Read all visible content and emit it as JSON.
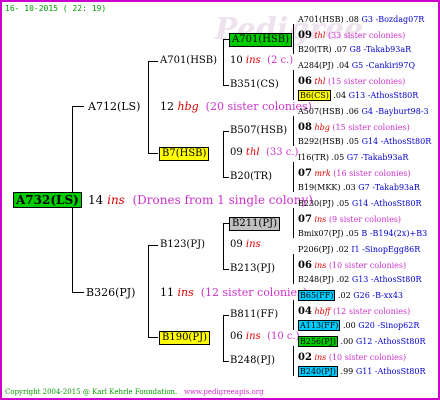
{
  "header": {
    "date": "16- 10-2015 ( 22: 19)"
  },
  "footer": {
    "copyright": "Copyright 2004-2015 @ Karl Kehrle Foundation.",
    "url": "www.pedigreeapis.org"
  },
  "watermark": "Pedigree",
  "colors": {
    "frame": "#cc00cc",
    "green_box": "#00cc00",
    "yellow_box": "#ffff00",
    "gray_box": "#c0c0c0",
    "cyan_box": "#00ccff"
  },
  "root": {
    "code": "A732(LS)",
    "num": "14",
    "sign": "ins",
    "note": "(Drones from 1 single colony)"
  },
  "gen1": {
    "top": {
      "code": "A712(LS)",
      "num": "12",
      "sign": "hbg",
      "note": "(20 sister colonies)"
    },
    "bottom": {
      "code": "B326(PJ)",
      "num": "11",
      "sign": "ins",
      "note": "(12 sister colonies)"
    }
  },
  "gen2": [
    {
      "code": "A701(HSB)",
      "num": "10",
      "sign": "ins",
      "note": "(2 c.)"
    },
    {
      "code": "B7(HSB)",
      "num": "09",
      "sign": "thl",
      "note": "(33 c.)"
    },
    {
      "code": "B123(PJ)",
      "num": "09",
      "sign": "ins",
      "note": ""
    },
    {
      "code": "B190(PJ)",
      "num": "06",
      "sign": "ins",
      "note": "(10 c.)"
    }
  ],
  "gen3": [
    {
      "code": "A701(HSB)"
    },
    {
      "code": "B351(CS)"
    },
    {
      "code": "B507(HSB)"
    },
    {
      "code": "B20(TR)"
    },
    {
      "code": "B211(PJ)"
    },
    {
      "code": "B213(PJ)"
    },
    {
      "code": "B811(FF)"
    },
    {
      "code": "B248(PJ)"
    }
  ],
  "gen4": [
    {
      "top": {
        "code": "A701(HSB)",
        "year": ".08",
        "sep": "G3 -",
        "breeder": "Bozdag07R"
      },
      "num": "09",
      "sign": "thl",
      "note": "(33 sister colonies)",
      "bottom": {
        "code": "B20(TR)",
        "year": ".07",
        "sep": "G8 -",
        "breeder": "Takab93aR"
      }
    },
    {
      "top": {
        "code": "A284(PJ)",
        "year": ".04",
        "sep": "G5 -",
        "breeder": "Cankiri97Q"
      },
      "num": "06",
      "sign": "thl",
      "note": "(15 sister colonies)",
      "bottom": {
        "code": "B6(CS)",
        "year": ".04",
        "sep": "G13 -",
        "breeder": "AthosSt80R"
      }
    },
    {
      "top": {
        "code": "A507(HSB)",
        "year": ".06",
        "sep": "G4 -",
        "breeder": "Bayburt98-3"
      },
      "num": "08",
      "sign": "hbg",
      "note": "(15 sister colonies)",
      "bottom": {
        "code": "B292(HSB)",
        "year": ".05",
        "sep": "G14 -",
        "breeder": "AthosSt80R"
      }
    },
    {
      "top": {
        "code": "I16(TR)",
        "year": ".05",
        "sep": "G7 -",
        "breeder": "Takab93aR"
      },
      "num": "07",
      "sign": "mrk",
      "note": "(16 sister colonies)",
      "bottom": {
        "code": "B19(MKK)",
        "year": ".03",
        "sep": "G7 -",
        "breeder": "Takab93aR"
      }
    },
    {
      "top": {
        "code": "B230(PJ)",
        "year": ".05",
        "sep": "G14 -",
        "breeder": "AthosSt80R"
      },
      "num": "07",
      "sign": "ins",
      "note": "(9 sister colonies)",
      "bottom": {
        "code": "Bmix07(PJ)",
        "year": ".05",
        "sep": "B -",
        "breeder": "B194(2x)+B3"
      }
    },
    {
      "top": {
        "code": "P206(PJ)",
        "year": ".02",
        "sep": "I1 -",
        "breeder": "SinopEgg86R"
      },
      "num": "06",
      "sign": "ins",
      "note": "(10 sister colonies)",
      "bottom": {
        "code": "B248(PJ)",
        "year": ".02",
        "sep": "G13 -",
        "breeder": "AthosSt80R"
      }
    },
    {
      "top": {
        "code": "B65(FF)",
        "year": ".02",
        "sep": "G26 -",
        "breeder": "B-xx43"
      },
      "num": "04",
      "sign": "hbff",
      "note": "(12 sister colonies)",
      "bottom": {
        "code": "A113(FF)",
        "year": ".00",
        "sep": "G20 -",
        "breeder": "Sinop62R"
      }
    },
    {
      "top": {
        "code": "B256(PJ)",
        "year": ".00",
        "sep": "G12 -",
        "breeder": "AthosSt80R"
      },
      "num": "02",
      "sign": "ins",
      "note": "(10 sister colonies)",
      "bottom": {
        "code": "B240(PJ)",
        "year": ".99",
        "sep": "G11 -",
        "breeder": "AthosSt80R"
      }
    }
  ]
}
